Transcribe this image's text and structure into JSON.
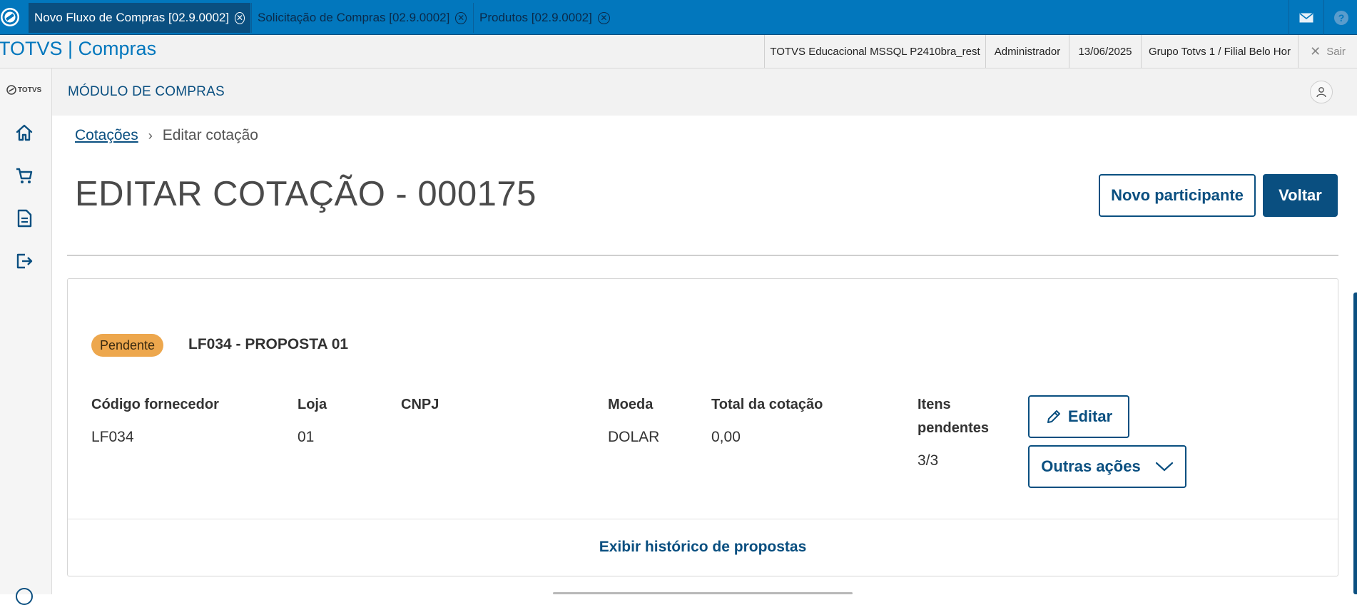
{
  "tabs": [
    {
      "label": "Novo Fluxo de Compras [02.9.0002]",
      "active": true
    },
    {
      "label": "Solicitação de Compras [02.9.0002]",
      "active": false
    },
    {
      "label": "Produtos [02.9.0002]",
      "active": false
    }
  ],
  "top_icons": [
    "mail-icon",
    "help-icon"
  ],
  "app_title": "TOTVS | Compras",
  "info": {
    "environment": "TOTVS Educacional MSSQL P2410bra_rest",
    "user": "Administrador",
    "date": "13/06/2025",
    "branch": "Grupo Totvs 1 / Filial Belo Hor",
    "exit_label": "Sair"
  },
  "sidebar": {
    "logo_text": "TOTVS",
    "items": [
      "home-icon",
      "cart-icon",
      "document-icon",
      "logout-icon"
    ]
  },
  "module_title": "MÓDULO DE COMPRAS",
  "breadcrumb": {
    "parent": "Cotações",
    "current": "Editar cotação"
  },
  "page_title": "EDITAR COTAÇÃO - 000175",
  "buttons": {
    "new_participant": "Novo participante",
    "back": "Voltar"
  },
  "card": {
    "status": "Pendente",
    "proposal_name": "LF034 - PROPOSTA 01",
    "fields": {
      "supplier_code_label": "Código fornecedor",
      "supplier_code": "LF034",
      "store_label": "Loja",
      "store": "01",
      "cnpj_label": "CNPJ",
      "cnpj": "",
      "currency_label": "Moeda",
      "currency": "DOLAR",
      "total_label": "Total da cotação",
      "total": "0,00",
      "pending_items_label_1": "Itens",
      "pending_items_label_2": "pendentes",
      "pending_items": "3/3"
    },
    "edit_button": "Editar",
    "other_actions_button": "Outras ações",
    "history_link": "Exibir histórico de propostas"
  },
  "colors": {
    "brand_blue": "#0277bd",
    "dark_blue": "#0a4f80",
    "pending": "#eda74d"
  }
}
